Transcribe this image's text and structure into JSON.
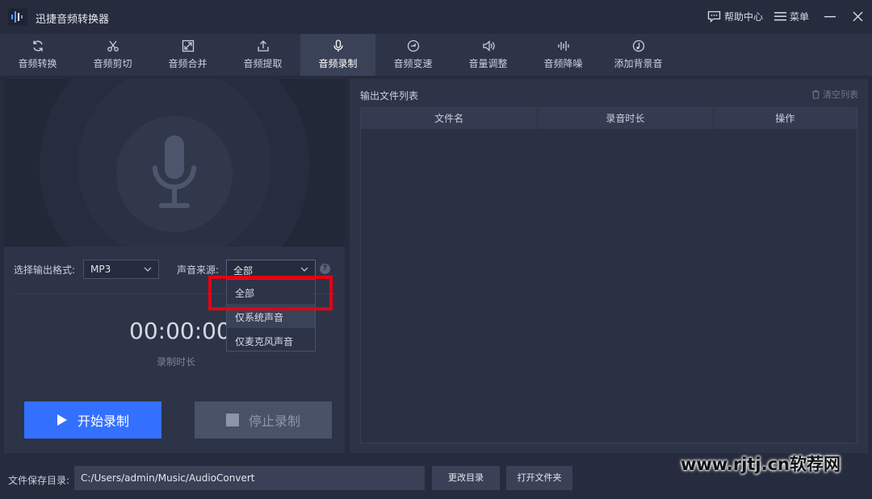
{
  "app": {
    "title": "迅捷音频转换器",
    "help_label": "帮助中心",
    "menu_label": "菜单",
    "accent_color": "#3370ff"
  },
  "toolbar": {
    "tools": [
      {
        "label": "音频转换",
        "icon": "refresh-icon"
      },
      {
        "label": "音频剪切",
        "icon": "scissors-icon"
      },
      {
        "label": "音频合并",
        "icon": "merge-icon"
      },
      {
        "label": "音频提取",
        "icon": "extract-icon"
      },
      {
        "label": "音频录制",
        "icon": "microphone-icon",
        "active": true
      },
      {
        "label": "音频变速",
        "icon": "speed-icon"
      },
      {
        "label": "音量调整",
        "icon": "volume-icon"
      },
      {
        "label": "音频降噪",
        "icon": "noise-icon"
      },
      {
        "label": "添加背景音",
        "icon": "music-note-icon"
      }
    ]
  },
  "recorder": {
    "format_label": "选择输出格式:",
    "format_value": "MP3",
    "source_label": "声音来源:",
    "source_value": "全部",
    "source_options": [
      "全部",
      "仅系统声音",
      "仅麦克风声音"
    ],
    "timer_value": "00:00:00",
    "timer_label": "录制时长",
    "start_label": "开始录制",
    "stop_label": "停止录制"
  },
  "output": {
    "title": "输出文件列表",
    "clear_label": "清空列表",
    "columns": [
      "文件名",
      "录音时长",
      "操作"
    ]
  },
  "footer": {
    "save_dir_label": "文件保存目录:",
    "save_dir_value": "C:/Users/admin/Music/AudioConvert",
    "change_dir_label": "更改目录",
    "open_folder_label": "打开文件夹"
  },
  "watermark": "www.rjtj.cn软荐网"
}
